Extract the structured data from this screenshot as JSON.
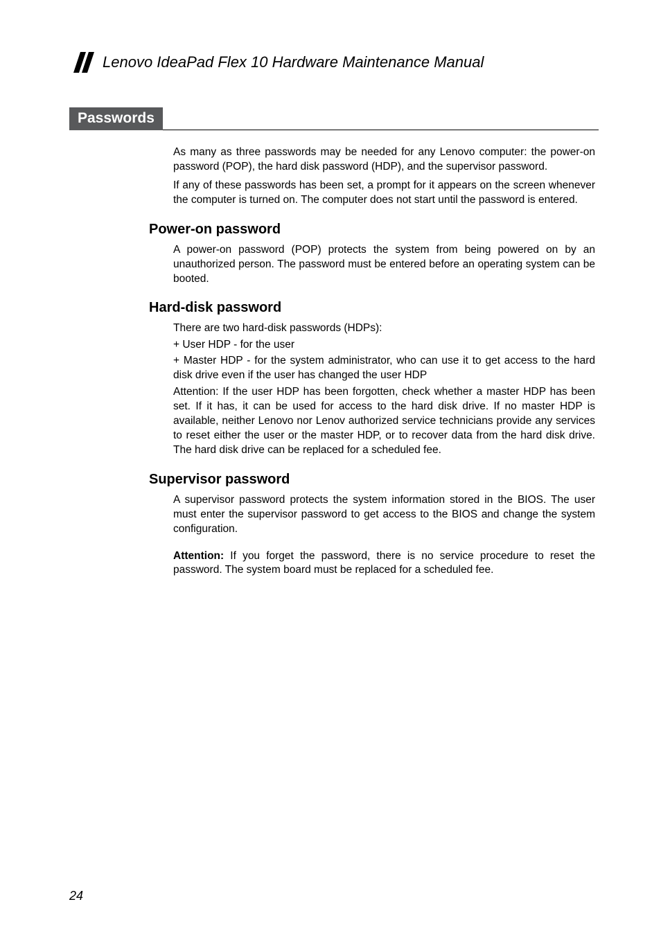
{
  "header": {
    "title": "Lenovo IdeaPad Flex 10 Hardware Maintenance Manual"
  },
  "section": {
    "title": "Passwords",
    "intro1": "As many as three passwords may be needed for any Lenovo computer: the power-on password (POP), the hard disk password (HDP), and the supervisor password.",
    "intro2": "If any of these passwords has been set, a prompt for it appears on the screen whenever the computer is turned on. The computer does not start until the password is entered."
  },
  "power_on": {
    "heading": "Power-on password",
    "text": "A power-on password (POP) protects the system from being powered on by an unauthorized person. The password must be entered before an operating system can be booted."
  },
  "hard_disk": {
    "heading": "Hard-disk password",
    "intro": "There are two hard-disk passwords (HDPs):",
    "item1": "+ User HDP - for the user",
    "item2": "+ Master HDP - for the system administrator, who can use it to get access to the hard disk drive even if the user has changed the user HDP",
    "attention": "Attention: If the user HDP has been forgotten, check whether a master HDP has been set. If it has, it can be used for access to the hard disk drive. If no master HDP is available, neither Lenovo nor Lenov authorized service technicians provide any services to reset either the user or the master HDP, or to recover data from the hard disk drive. The hard disk drive can be replaced for a scheduled fee."
  },
  "supervisor": {
    "heading": "Supervisor password",
    "text": "A supervisor password protects the system information stored in the BIOS. The user must enter the supervisor password to get access to the BIOS and change the system configuration.",
    "attention_label": "Attention:",
    "attention_text": " If you forget the password, there is no service procedure to reset the password. The system board must be replaced for a scheduled fee."
  },
  "page_number": "24"
}
